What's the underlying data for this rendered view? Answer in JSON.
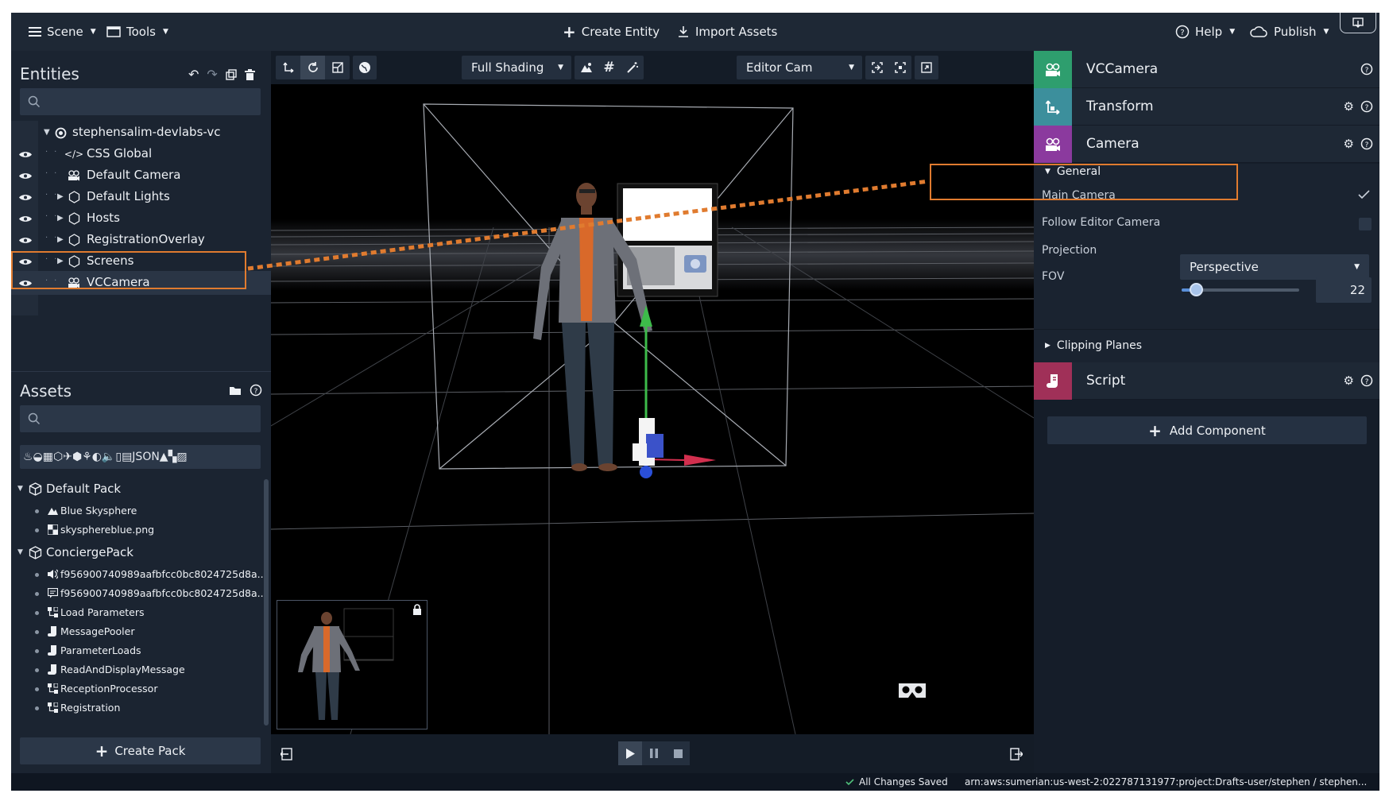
{
  "topbar": {
    "scene_label": "Scene",
    "tools_label": "Tools",
    "create_entity_label": "Create Entity",
    "import_assets_label": "Import Assets",
    "help_label": "Help",
    "publish_label": "Publish"
  },
  "entities": {
    "title": "Entities",
    "search_placeholder": "",
    "items": [
      {
        "label": "stephensalim-devlabs-vc",
        "icon": "scene-icon"
      },
      {
        "label": "CSS Global",
        "icon": "code-icon"
      },
      {
        "label": "Default Camera",
        "icon": "camera-icon"
      },
      {
        "label": "Default Lights",
        "icon": "hexagon-icon"
      },
      {
        "label": "Hosts",
        "icon": "hexagon-icon"
      },
      {
        "label": "RegistrationOverlay",
        "icon": "hexagon-icon"
      },
      {
        "label": "Screens",
        "icon": "hexagon-icon"
      },
      {
        "label": "VCCamera",
        "icon": "camera-icon"
      }
    ]
  },
  "assets": {
    "title": "Assets",
    "search_placeholder": "",
    "type_filter_icons": "♨◒▦⬡✈⬢⚘◐🔈▯▤JSON▲▚▨",
    "packs": [
      {
        "name": "Default Pack",
        "items": [
          {
            "label": "Blue Skysphere",
            "icon": "skysphere-icon"
          },
          {
            "label": "skysphereblue.png",
            "icon": "texture-icon"
          }
        ]
      },
      {
        "name": "ConciergePack",
        "items": [
          {
            "label": "f956900740989aafbfcc0bc8024725d8a...",
            "icon": "sound-icon"
          },
          {
            "label": "f956900740989aafbfcc0bc8024725d8a...",
            "icon": "speech-icon"
          },
          {
            "label": "Load Parameters",
            "icon": "state-machine-icon"
          },
          {
            "label": "MessagePooler",
            "icon": "script-icon"
          },
          {
            "label": "ParameterLoads",
            "icon": "script-icon"
          },
          {
            "label": "ReadAndDisplayMessage",
            "icon": "script-icon"
          },
          {
            "label": "ReceptionProcessor",
            "icon": "state-machine-icon"
          },
          {
            "label": "Registration",
            "icon": "state-machine-icon"
          }
        ]
      }
    ],
    "create_pack_label": "Create Pack"
  },
  "viewport": {
    "shading_label": "Full Shading",
    "camera_label": "Editor Cam"
  },
  "inspector": {
    "entity_name": "VCCamera",
    "components": [
      {
        "name": "Transform",
        "color": "#3c8f9c"
      },
      {
        "name": "Camera",
        "color": "#8b3a9e"
      },
      {
        "name": "Script",
        "color": "#a03058"
      }
    ],
    "entity_color": "#2e9e6e",
    "general_label": "General",
    "main_camera_label": "Main Camera",
    "main_camera_checked": true,
    "follow_editor_label": "Follow Editor Camera",
    "follow_editor_checked": false,
    "projection_label": "Projection",
    "projection_value": "Perspective",
    "fov_label": "FOV",
    "fov_value": "22",
    "fov_fraction": 0.12,
    "clipping_label": "Clipping Planes",
    "add_component_label": "Add Component"
  },
  "status": {
    "saved_label": "All Changes Saved",
    "arn_label": "arn:aws:sumerian:us-west-2:022787131977:project:Drafts-user/stephen  /  stephen..."
  },
  "colors": {
    "highlight": "#e07b2f",
    "accent": "#5a8fd8"
  }
}
